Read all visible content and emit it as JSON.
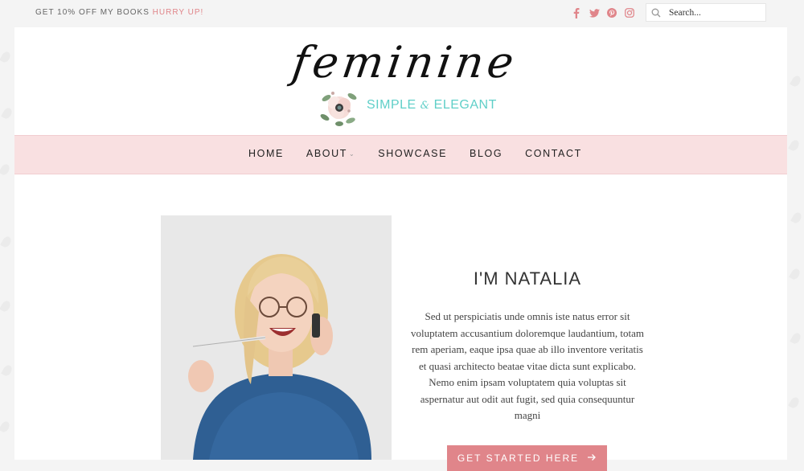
{
  "topbar": {
    "promo_text": "GET 10% OFF MY BOOKS",
    "promo_highlight": "HURRY UP!",
    "social_icons": [
      "facebook-icon",
      "twitter-icon",
      "pinterest-icon",
      "instagram-icon"
    ],
    "search_placeholder": "Search..."
  },
  "logo": {
    "wordmark": "feminine",
    "tagline_left": "SIMPLE",
    "tagline_amp": "&",
    "tagline_right": "ELEGANT"
  },
  "nav": {
    "items": [
      "HOME",
      "ABOUT",
      "SHOWCASE",
      "BLOG",
      "CONTACT"
    ]
  },
  "about": {
    "title": "I'M NATALIA",
    "text": "Sed ut perspiciatis unde omnis iste natus error sit voluptatem accusantium doloremque laudantium, totam rem aperiam, eaque ipsa quae ab illo inventore veritatis et quasi architecto beatae vitae dicta sunt explicabo. Nemo enim ipsam voluptatem quia voluptas sit aspernatur aut odit aut fugit, sed quia consequuntur magni",
    "cta_label": "GET STARTED HERE"
  },
  "colors": {
    "accent": "#e0858a",
    "nav_bg": "#f9e0e1",
    "teal": "#5fcfc8"
  }
}
